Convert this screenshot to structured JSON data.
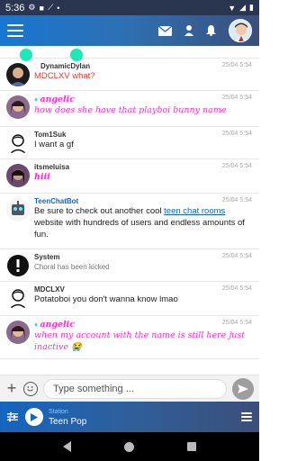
{
  "status_bar": {
    "time": "5:36"
  },
  "header": {
    "icons": [
      "menu-icon",
      "mail-icon",
      "person-icon",
      "bell-icon",
      "avatar"
    ]
  },
  "feed": {
    "messages": [
      {
        "user": "DynamicDylan",
        "time": "25/04 5:54",
        "text": "MDCLXV what?",
        "style": "red"
      },
      {
        "user": "angelic",
        "time": "25/04 5:54",
        "text": "how does she have that playboi bunny name",
        "style": "fancy"
      },
      {
        "user": "Tom1Suk",
        "time": "25/04 5:54",
        "text": "I want a gf",
        "style": "normal"
      },
      {
        "user": "itsmeluisa",
        "time": "25/04 5:54",
        "text": "hiii",
        "style": "fancy"
      },
      {
        "user": "TeenChatBot",
        "time": "25/04 5:54",
        "text_before": "Be sure to check out another cool ",
        "link": "teen chat rooms",
        "text_after": " website with hundreds of users and endless amounts of fun.",
        "style": "bot"
      },
      {
        "user": "System",
        "time": "25/04 5:54",
        "text": "Choral has been kicked",
        "style": "system"
      },
      {
        "user": "MDCLXV",
        "time": "25/04 5:54",
        "text": "Potatoboi you don't wanna know lmao",
        "style": "normal"
      },
      {
        "user": "angelic",
        "time": "25/04 5:54",
        "text": "when my account with the name is still here just inactive 😭",
        "style": "fancy"
      }
    ]
  },
  "composer": {
    "placeholder": "Type something ..."
  },
  "player": {
    "station_line1": "Station",
    "station_name": "Teen Pop"
  },
  "colors": {
    "accent": "#1976d2",
    "fancy_pink": "#ff2bd0",
    "red": "#e53935",
    "link": "#1565c0"
  }
}
